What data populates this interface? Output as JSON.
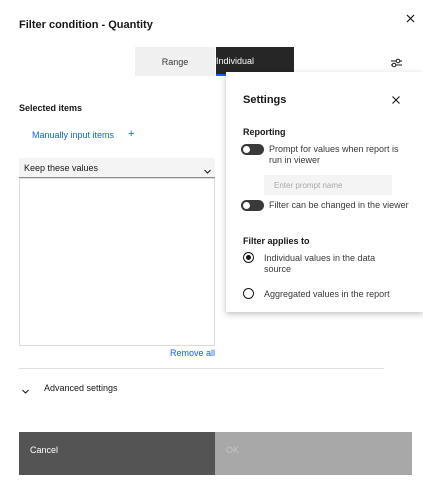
{
  "dialog": {
    "title": "Filter condition - Quantity",
    "close_icon": "close-icon"
  },
  "tabs": [
    {
      "label": "Range",
      "selected": false
    },
    {
      "label": "Individual",
      "selected": true
    }
  ],
  "settings_button_icon": "sliders-icon",
  "selected_items": {
    "label": "Selected items",
    "manual_link": "Manually input items",
    "manual_link_icon": "plus-icon",
    "select_value": "Keep these values",
    "remove_all": "Remove all"
  },
  "advanced": {
    "label": "Advanced settings",
    "expanded": false
  },
  "footer": {
    "cancel": "Cancel",
    "ok": "OK",
    "ok_enabled": false
  },
  "settings_panel": {
    "title": "Settings",
    "reporting_heading": "Reporting",
    "prompt_toggle_label": "Prompt for values when report is run in viewer",
    "prompt_toggle_on": false,
    "prompt_placeholder": "Enter prompt name",
    "filter_changed_label": "Filter can be changed in the viewer",
    "filter_changed_on": false,
    "applies_heading": "Filter applies to",
    "radio_options": [
      {
        "label": "Individual values in the data source",
        "checked": true
      },
      {
        "label": "Aggregated values in the report",
        "checked": false
      }
    ]
  },
  "colors": {
    "link": "#0f62fe",
    "tab_selected_bg": "#262626",
    "footer_cancel_bg": "#545454",
    "footer_ok_bg": "#a8a8a8"
  }
}
